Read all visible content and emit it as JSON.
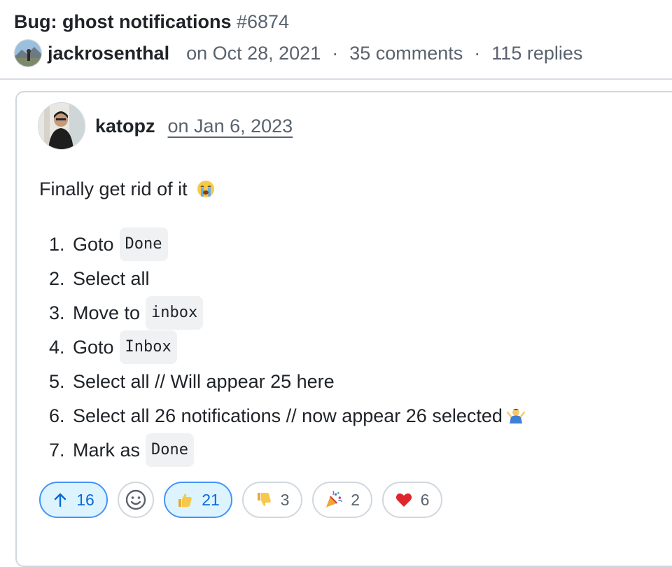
{
  "discussion": {
    "title": "Bug: ghost notifications",
    "number": "#6874",
    "author": "jackrosenthal",
    "date": "on Oct 28, 2021",
    "comments": "35 comments",
    "replies": "115 replies",
    "separator": "·"
  },
  "comment": {
    "author": "katopz",
    "date": "on Jan 6, 2023",
    "intro": "Finally get rid of it",
    "intro_emoji": "loudly-crying-face-icon",
    "steps": [
      {
        "num": "1.",
        "text": "Goto",
        "code": "Done",
        "after": ""
      },
      {
        "num": "2.",
        "text": "Select all",
        "code": "",
        "after": ""
      },
      {
        "num": "3.",
        "text": "Move to",
        "code": "inbox",
        "after": ""
      },
      {
        "num": "4.",
        "text": "Goto",
        "code": "Inbox",
        "after": ""
      },
      {
        "num": "5.",
        "text": "Select all // Will appear 25 here",
        "code": "",
        "after": ""
      },
      {
        "num": "6.",
        "text": "Select all 26 notifications // now appear 26 selected",
        "code": "",
        "after": "shrug-icon"
      },
      {
        "num": "7.",
        "text": "Mark as",
        "code": "Done",
        "after": ""
      }
    ]
  },
  "reactions": {
    "upvote": "16",
    "thumbs_up": "21",
    "thumbs_down": "3",
    "tada": "2",
    "heart": "6"
  },
  "colors": {
    "accent": "#0969da",
    "active_bg": "#ddf4ff",
    "active_border": "#4493f8",
    "muted": "#59636e",
    "border": "#d0d7de"
  }
}
